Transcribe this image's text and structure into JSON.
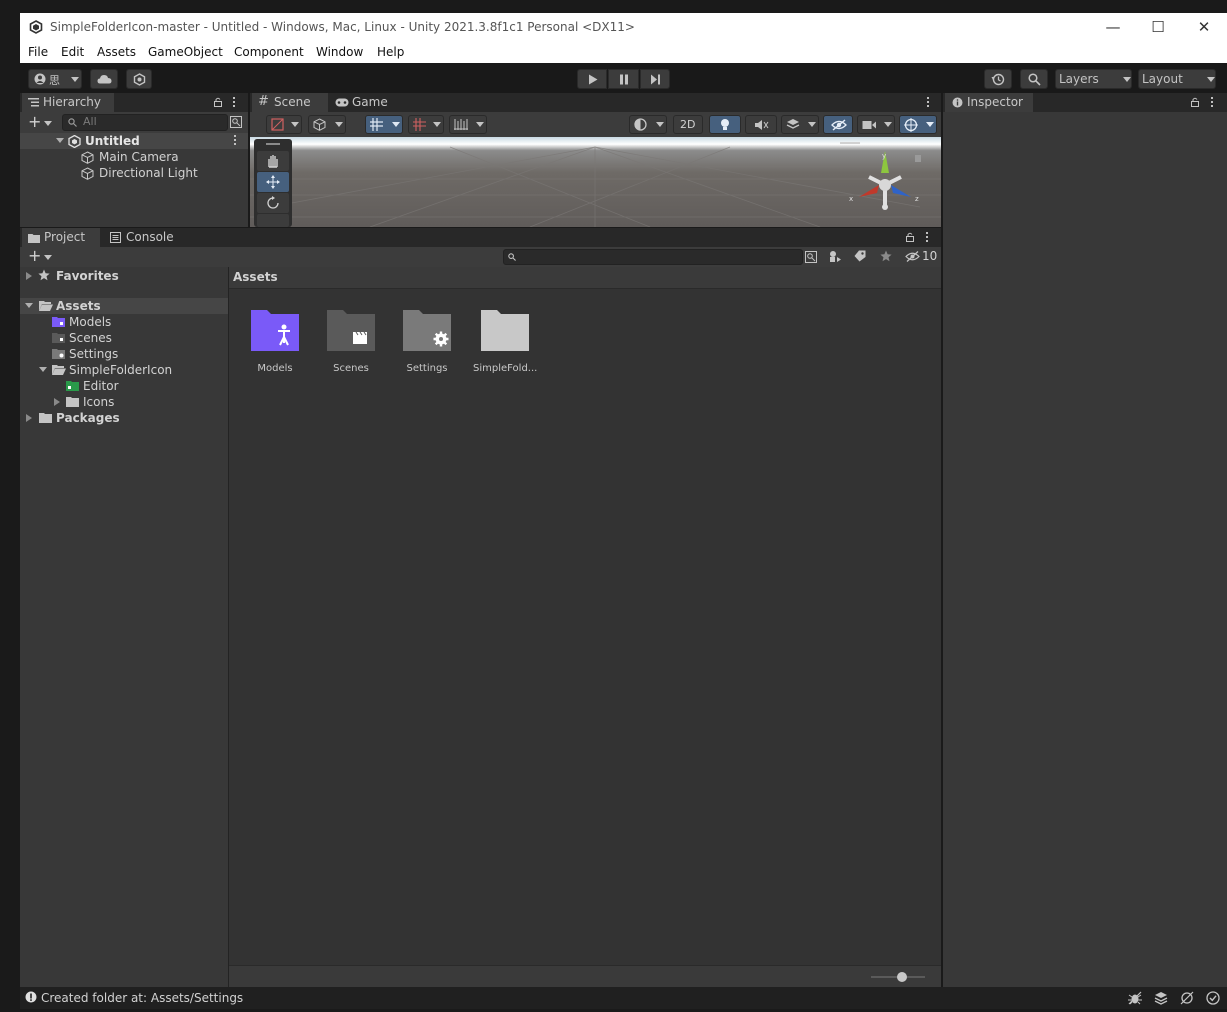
{
  "window": {
    "title": "SimpleFolderIcon-master - Untitled - Windows, Mac, Linux - Unity 2021.3.8f1c1 Personal <DX11>",
    "controls": {
      "minimize": "—",
      "maximize": "☐",
      "close": "✕"
    }
  },
  "menu": [
    "File",
    "Edit",
    "Assets",
    "GameObject",
    "Component",
    "Window",
    "Help"
  ],
  "toolbar": {
    "account_label": "思",
    "layers_label": "Layers",
    "layout_label": "Layout"
  },
  "hierarchy": {
    "tab_label": "Hierarchy",
    "search_placeholder": "All",
    "scene_name": "Untitled",
    "items": [
      "Main Camera",
      "Directional Light"
    ]
  },
  "scene_view": {
    "tabs": [
      "Scene",
      "Game"
    ],
    "mode_2d": "2D",
    "gizmo_axes": {
      "y": "y",
      "x": "x",
      "z": "z"
    }
  },
  "inspector": {
    "tab_label": "Inspector"
  },
  "project": {
    "tabs": [
      "Project",
      "Console"
    ],
    "hidden_count": "10",
    "tree": {
      "favorites": "Favorites",
      "assets": "Assets",
      "children": [
        "Models",
        "Scenes",
        "Settings",
        "SimpleFolderIcon"
      ],
      "simplefoldericon_children": [
        "Editor",
        "Icons"
      ],
      "packages": "Packages"
    },
    "breadcrumb": "Assets",
    "grid_items": [
      {
        "label": "Models",
        "icon": "models-folder-icon"
      },
      {
        "label": "Scenes",
        "icon": "scenes-folder-icon"
      },
      {
        "label": "Settings",
        "icon": "settings-folder-icon"
      },
      {
        "label": "SimpleFold...",
        "icon": "plain-folder-icon"
      }
    ]
  },
  "status": {
    "message": "Created folder at: Assets/Settings"
  },
  "colors": {
    "accent": "#3a72b0",
    "models_folder": "#7a5af8",
    "folder_gray": "#5a5a5a",
    "folder_light": "#c8c8c8",
    "editor_folder": "#2a9a4a"
  }
}
